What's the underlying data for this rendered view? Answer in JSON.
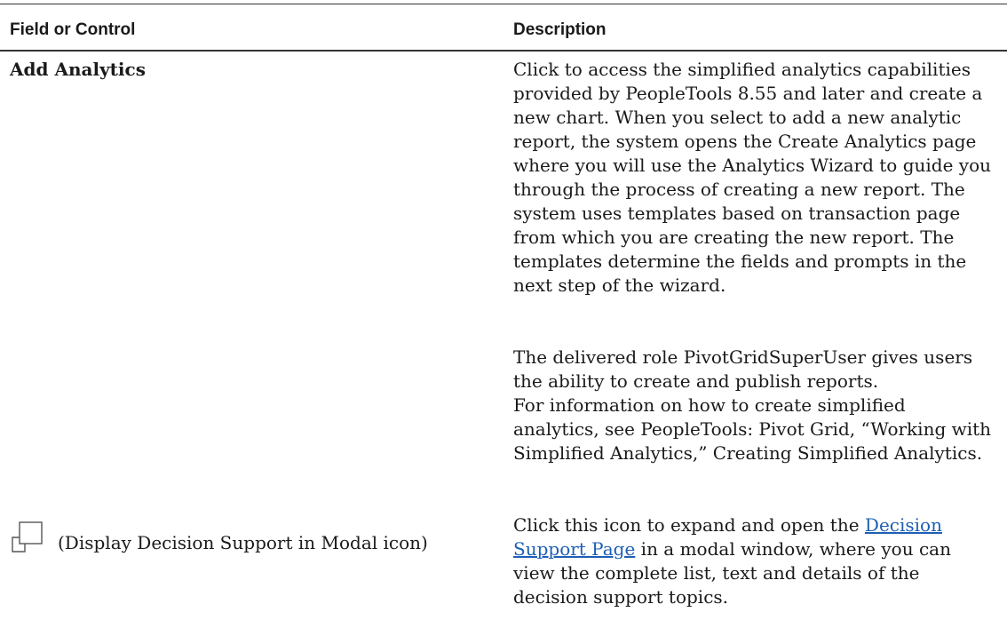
{
  "table": {
    "headers": {
      "field": "Field or Control",
      "description": "Description"
    },
    "rows": [
      {
        "field": "Add Analytics",
        "description": [
          "Click to access the simplified analytics capabilities provided by PeopleTools 8.55 and later and create a new chart. When you select to add a new analytic report, the system opens the Create Analytics page where you will use the Analytics Wizard to guide you through the process of creating a new report. The system uses templates based on transaction page from which you are creating the new report. The templates determine the fields and prompts in the next step of the wizard.",
          "The delivered role PivotGridSuperUser gives users the ability to create and publish reports.",
          "For information on how to create simplified analytics, see PeopleTools: Pivot Grid, “Working with Simplified Analytics,” Creating Simplified Analytics."
        ]
      },
      {
        "field_icon": "display-in-modal-icon",
        "field": "(Display Decision Support in Modal icon)",
        "description_before_link": "Click this icon to expand and open the ",
        "description_link": "Decision Support Page",
        "description_after_link": " in a modal window, where you can view the complete list, text and details of the decision support topics."
      }
    ]
  },
  "colors": {
    "text": "#1a1a1a",
    "link": "#1e5fb4",
    "rule": "#333333"
  }
}
